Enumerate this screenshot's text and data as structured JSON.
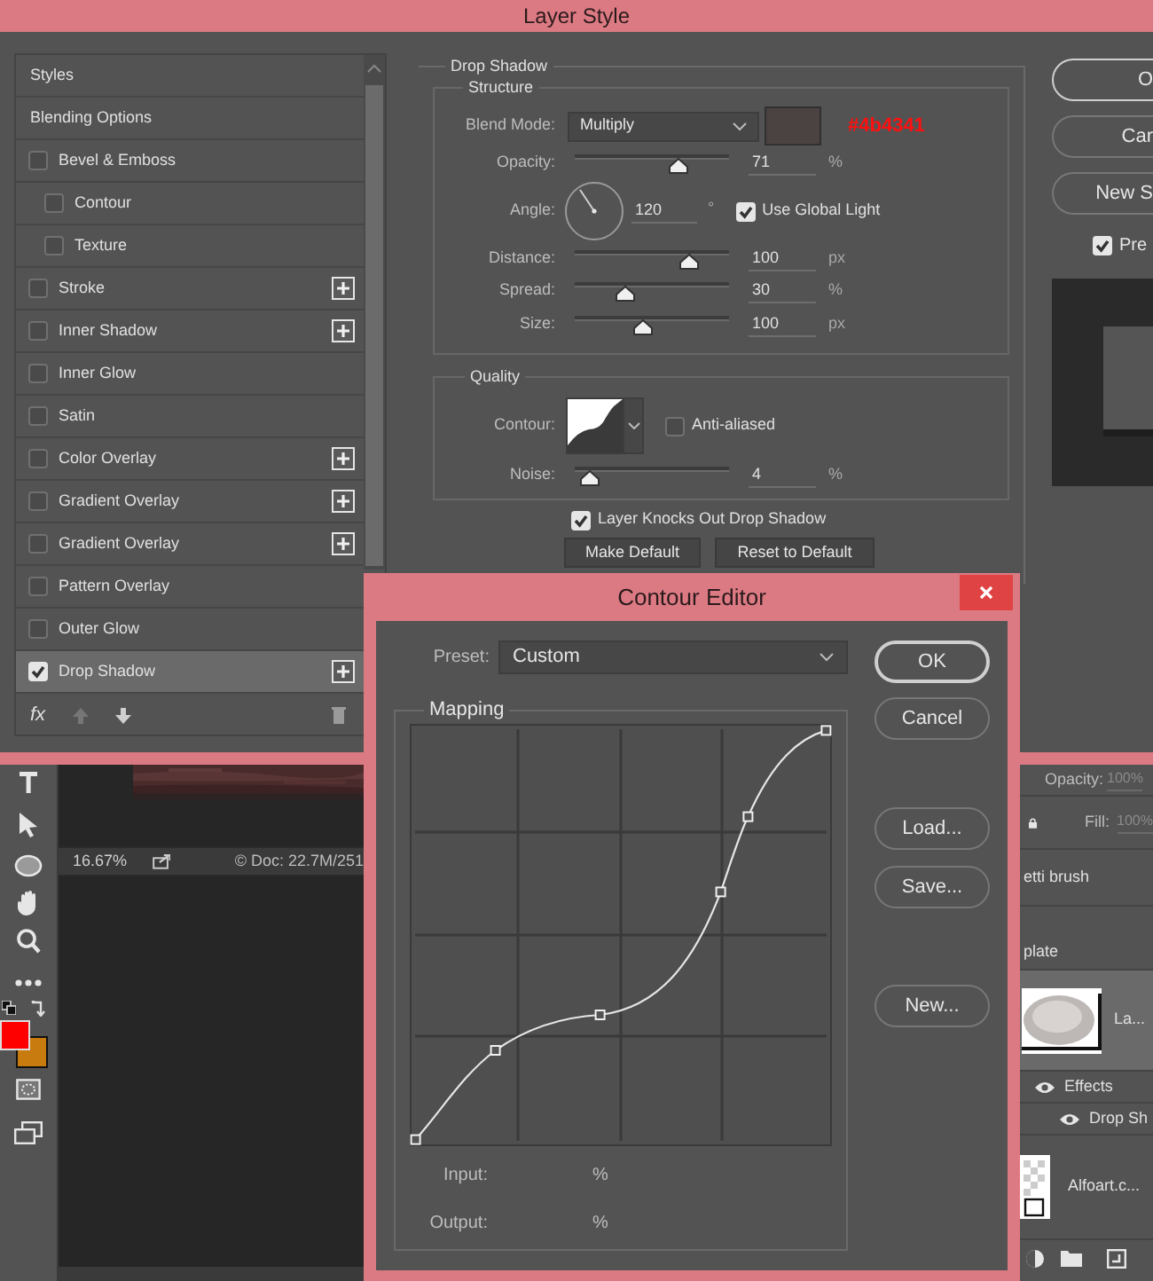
{
  "layer_style": {
    "title": "Layer Style",
    "styles_list": [
      {
        "label": "Styles",
        "kind": "header",
        "add_button": false,
        "selected": false
      },
      {
        "label": "Blending Options",
        "kind": "header",
        "add_button": false,
        "selected": false
      },
      {
        "label": "Bevel & Emboss",
        "kind": "check",
        "checked": false,
        "add_button": false,
        "selected": false
      },
      {
        "label": "Contour",
        "kind": "sub",
        "checked": false,
        "add_button": false,
        "selected": false
      },
      {
        "label": "Texture",
        "kind": "sub",
        "checked": false,
        "add_button": false,
        "selected": false
      },
      {
        "label": "Stroke",
        "kind": "check",
        "checked": false,
        "add_button": true,
        "selected": false
      },
      {
        "label": "Inner Shadow",
        "kind": "check",
        "checked": false,
        "add_button": true,
        "selected": false
      },
      {
        "label": "Inner Glow",
        "kind": "check",
        "checked": false,
        "add_button": false,
        "selected": false
      },
      {
        "label": "Satin",
        "kind": "check",
        "checked": false,
        "add_button": false,
        "selected": false
      },
      {
        "label": "Color Overlay",
        "kind": "check",
        "checked": false,
        "add_button": true,
        "selected": false
      },
      {
        "label": "Gradient Overlay",
        "kind": "check",
        "checked": false,
        "add_button": true,
        "selected": false
      },
      {
        "label": "Gradient Overlay",
        "kind": "check",
        "checked": false,
        "add_button": true,
        "selected": false
      },
      {
        "label": "Pattern Overlay",
        "kind": "check",
        "checked": false,
        "add_button": false,
        "selected": false
      },
      {
        "label": "Outer Glow",
        "kind": "check",
        "checked": false,
        "add_button": false,
        "selected": false
      },
      {
        "label": "Drop Shadow",
        "kind": "check",
        "checked": true,
        "add_button": true,
        "selected": true
      }
    ],
    "fx_label": "fx",
    "drop_shadow": {
      "title": "Drop Shadow",
      "structure_title": "Structure",
      "blend_mode": {
        "label": "Blend Mode:",
        "value": "Multiply"
      },
      "color_note": "#4b4341",
      "opacity": {
        "label": "Opacity:",
        "value": "71",
        "unit": "%",
        "level": 0.7
      },
      "angle": {
        "label": "Angle:",
        "value": "120",
        "unit": "°"
      },
      "global_light": {
        "label": "Use Global Light",
        "checked": true
      },
      "distance": {
        "label": "Distance:",
        "value": "100",
        "unit": "px",
        "level": 0.77
      },
      "spread": {
        "label": "Spread:",
        "value": "30",
        "unit": "%",
        "level": 0.3
      },
      "size": {
        "label": "Size:",
        "value": "100",
        "unit": "px",
        "level": 0.44
      },
      "quality_title": "Quality",
      "contour_label": "Contour:",
      "anti_aliased": {
        "label": "Anti-aliased",
        "checked": false
      },
      "noise": {
        "label": "Noise:",
        "value": "4",
        "unit": "%",
        "level": 0.04
      },
      "knockout": {
        "label": "Layer Knocks Out Drop Shadow",
        "checked": true
      },
      "buttons": [
        "Make Default",
        "Reset to Default"
      ]
    },
    "side_buttons": [
      "O",
      "Car",
      "New S"
    ],
    "preview": {
      "label": "Pre",
      "checked": true
    }
  },
  "canvas_status": {
    "zoom": "16.67%",
    "doc": "© Doc: 22.7M/251"
  },
  "layers_panel": {
    "opacity_label": "Opacity:",
    "opacity_value": "100%",
    "fill_label": "Fill:",
    "fill_value": "100%",
    "rows": [
      {
        "kind": "plain",
        "name": "etti brush",
        "selected": false
      },
      {
        "kind": "plain",
        "name": "plate",
        "selected": false
      },
      {
        "kind": "thumb",
        "name": "La...",
        "selected": true
      },
      {
        "kind": "effect",
        "name": "Effects",
        "selected": false
      },
      {
        "kind": "sub_effect",
        "name": "Drop Sh",
        "selected": false
      },
      {
        "kind": "transparent",
        "name": "Alfoart.c...",
        "selected": false
      }
    ]
  },
  "contour_editor": {
    "title": "Contour Editor",
    "preset_label": "Preset:",
    "preset_value": "Custom",
    "mapping_title": "Mapping",
    "input_label": "Input:",
    "input_unit": "%",
    "output_label": "Output:",
    "output_unit": "%",
    "buttons": [
      {
        "label": "OK",
        "kind": "default"
      },
      {
        "label": "Cancel",
        "kind": "normal"
      },
      {
        "label": "Load...",
        "kind": "normal"
      },
      {
        "label": "Save...",
        "kind": "normal"
      },
      {
        "label": "New...",
        "kind": "normal"
      }
    ]
  }
}
